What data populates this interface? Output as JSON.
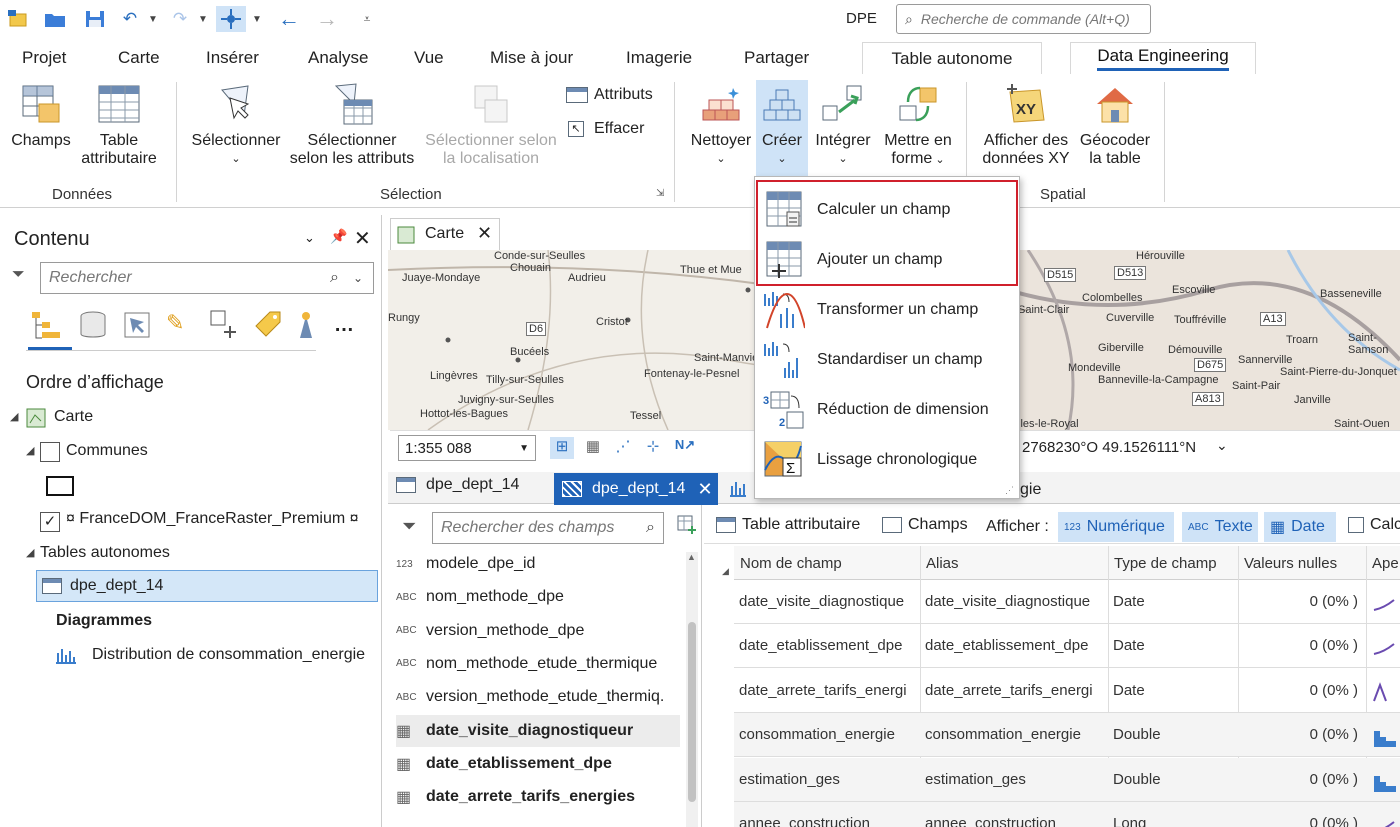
{
  "app": {
    "title": "DPE",
    "command_search_placeholder": "Recherche de commande (Alt+Q)"
  },
  "ribbon_tabs": [
    "Projet",
    "Carte",
    "Insérer",
    "Analyse",
    "Vue",
    "Mise à jour",
    "Imagerie",
    "Partager"
  ],
  "context_tabs": [
    "Table autonome",
    "Data Engineering"
  ],
  "ribbon": {
    "champs": "Champs",
    "table_attributaire_1": "Table",
    "table_attributaire_2": "attributaire",
    "selectionner": "Sélectionner",
    "select_attr_1": "Sélectionner",
    "select_attr_2": "selon les attributs",
    "select_loc_1": "Sélectionner selon",
    "select_loc_2": "la localisation",
    "attributs": "Attributs",
    "effacer": "Effacer",
    "nettoyer": "Nettoyer",
    "creer": "Créer",
    "integrer": "Intégrer",
    "mettre_forme_1": "Mettre en",
    "mettre_forme_2": "forme",
    "afficher_xy_1": "Afficher des",
    "afficher_xy_2": "données XY",
    "geocoder_1": "Géocoder",
    "geocoder_2": "la table",
    "group_donnees": "Données",
    "group_selection": "Sélection",
    "group_spatial": "Spatial"
  },
  "dropdown": {
    "items": [
      "Calculer un champ",
      "Ajouter un champ",
      "Transformer un champ",
      "Standardiser un champ",
      "Réduction de dimension",
      "Lissage chronologique"
    ]
  },
  "contents": {
    "title": "Contenu",
    "search_placeholder": "Rechercher",
    "order_label": "Ordre d’affichage",
    "tree": {
      "carte": "Carte",
      "communes": "Communes",
      "raster": "¤ FranceDOM_FranceRaster_Premium ¤",
      "tables_autonomes": "Tables autonomes",
      "dpe": "dpe_dept_14",
      "diagrammes": "Diagrammes",
      "distribution": "Distribution de consommation_energie"
    }
  },
  "map": {
    "tab": "Carte",
    "scale": "1:355 088",
    "coords": "2768230°O 49.1526111°N",
    "places": [
      "Conde-sur-Seulles",
      "Juaye-Mondaye",
      "Chouain",
      "Audrieu",
      "Thue et Mue",
      "Rungy",
      "Cristot",
      "Bucéels",
      "Lingèvres",
      "Tilly-sur-Seulles",
      "Saint-Manvieu",
      "Fontenay-le-Pesnel",
      "Juvigny-sur-Seulles",
      "Hottot-les-Bagues",
      "Tessel",
      "Hérouville",
      "Colombelles",
      "Escoville",
      "Basseneville",
      "Saint-Clair",
      "Cuverville",
      "Touffréville",
      "Giberville",
      "Démouville",
      "Troarn",
      "Saint-Samson",
      "Mondeville",
      "Sannerville",
      "Banneville-la-Campagne",
      "Saint-Pierre-du-Jonquet",
      "Saint-Pair",
      "Janville",
      "lles-le-Royal",
      "Saint-Ouen"
    ],
    "roads": [
      "D6",
      "D515",
      "D513",
      "A13",
      "D675",
      "A813"
    ]
  },
  "view_tabs": {
    "t1": "dpe_dept_14",
    "t2": "dpe_dept_14",
    "t3": "gie"
  },
  "fields_panel": {
    "search_placeholder": "Rechercher des champs",
    "items": [
      {
        "icon": "123",
        "name": "modele_dpe_id",
        "bold": false
      },
      {
        "icon": "ABC",
        "name": "nom_methode_dpe",
        "bold": false
      },
      {
        "icon": "ABC",
        "name": "version_methode_dpe",
        "bold": false
      },
      {
        "icon": "ABC",
        "name": "nom_methode_etude_thermique",
        "bold": false
      },
      {
        "icon": "ABC",
        "name": "version_methode_etude_thermiq.",
        "bold": false
      },
      {
        "icon": "date",
        "name": "date_visite_diagnostiqueur",
        "bold": true
      },
      {
        "icon": "date",
        "name": "date_etablissement_dpe",
        "bold": true
      },
      {
        "icon": "date",
        "name": "date_arrete_tarifs_energies",
        "bold": true
      }
    ]
  },
  "grid": {
    "toolbar": {
      "table": "Table attributaire",
      "champs": "Champs",
      "afficher": "Afficher :",
      "num": "Numérique",
      "texte": "Texte",
      "date": "Date",
      "calc": "Calc"
    },
    "headers": [
      "Nom de champ",
      "Alias",
      "Type de champ",
      "Valeurs nulles",
      "Ape"
    ],
    "rows": [
      [
        "date_visite_diagnostique",
        "date_visite_diagnostique",
        "Date",
        "0 (0% )"
      ],
      [
        "date_etablissement_dpe",
        "date_etablissement_dpe",
        "Date",
        "0 (0% )"
      ],
      [
        "date_arrete_tarifs_energi",
        "date_arrete_tarifs_energi",
        "Date",
        "0 (0% )"
      ],
      [
        "consommation_energie",
        "consommation_energie",
        "Double",
        "0 (0% )"
      ],
      [
        "estimation_ges",
        "estimation_ges",
        "Double",
        "0 (0% )"
      ],
      [
        "annee_construction",
        "annee_construction",
        "Long",
        "0 (0% )"
      ]
    ]
  }
}
